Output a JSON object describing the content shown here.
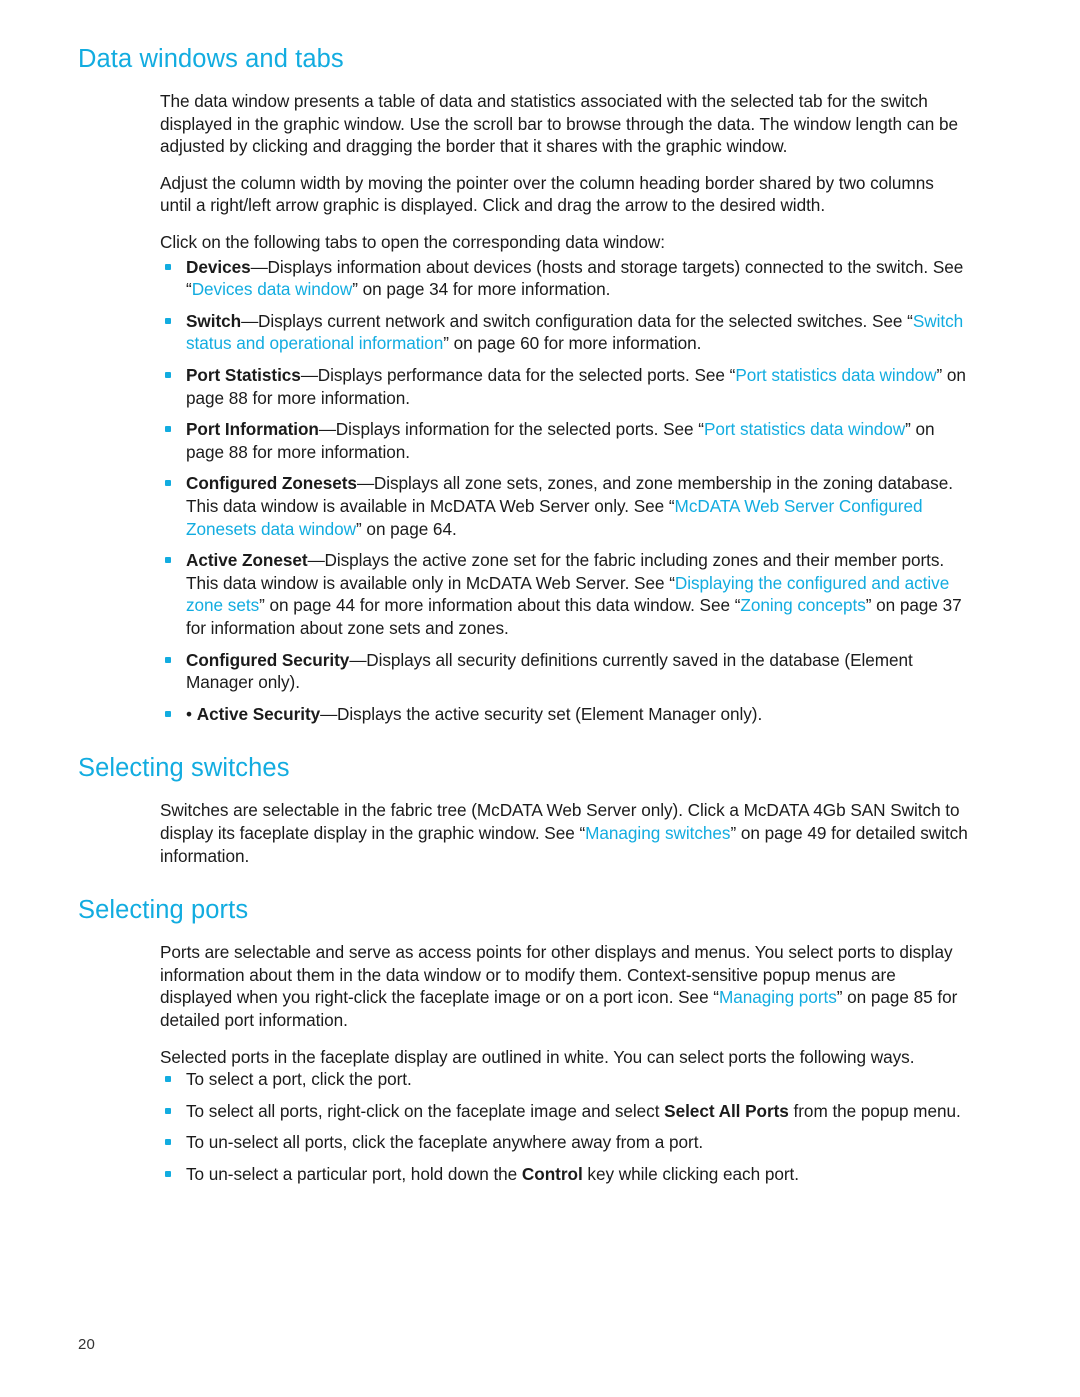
{
  "document": {
    "page_number": "20"
  },
  "sections": [
    {
      "heading": "Data windows and tabs",
      "paragraphs": [
        "The data window presents a table of data and statistics associated with the selected tab for the switch displayed in the graphic window. Use the scroll bar to browse through the data. The window length can be adjusted by clicking and dragging the border that it shares with the graphic window.",
        "Adjust the column width by moving the pointer over the column heading border shared by two columns until a right/left arrow graphic is displayed. Click and drag the arrow to the desired width.",
        "Click on the following tabs to open the corresponding data window:"
      ]
    },
    {
      "heading": "Selecting switches",
      "paragraphs": [
        "Switches are selectable in the fabric tree (McDATA Web Server only). Click a McDATA 4Gb SAN Switch to display its faceplate display in the graphic window. See “Managing switches” on page 49 for detailed switch information."
      ]
    },
    {
      "heading": "Selecting ports",
      "paragraphs": [
        "Ports are selectable and serve as access points for other displays and menus. You select ports to display information about them in the data window or to modify them. Context-sensitive popup menus are displayed when you right-click the faceplate image or on a port icon. See “Managing ports” on page 85 for detailed port information.",
        "Selected ports in the faceplate display are outlined in white. You can select ports the following ways."
      ]
    }
  ],
  "tabs_list": [
    {
      "term": "Devices",
      "dash": "—",
      "text_1": "Displays information about devices (hosts and storage targets) connected to the switch. See “",
      "link": "Devices data window",
      "text_2": "” on page 34 for more information."
    },
    {
      "term": "Switch",
      "dash": "—",
      "text_1": "Displays current network and switch configuration data for the selected switches. See “",
      "link": "Switch status and operational information",
      "text_2": "” on page 60 for more information."
    },
    {
      "term": "Port Statistics",
      "dash": "—",
      "text_1": "Displays performance data for the selected ports. See “",
      "link": "Port statistics data window",
      "text_2": "” on page 88 for more information."
    },
    {
      "term": "Port Information",
      "dash": "—",
      "text_1": "Displays information for the selected ports. See “",
      "link": "Port statistics data window",
      "text_2": "” on page 88 for more information."
    },
    {
      "term": "Configured Zonesets",
      "dash": "—",
      "text_1": "Displays all zone sets, zones, and zone membership in the zoning database. This data window is available in McDATA Web Server only. See “",
      "link": "McDATA Web Server Configured Zonesets data window",
      "text_2": "” on page 64."
    },
    {
      "term": "Active Zoneset",
      "dash": "—",
      "text_1": "Displays the active zone set for the fabric including zones and their member ports. This data window is available only in McDATA Web Server. See “",
      "link": "Displaying the configured and active zone sets",
      "text_2": "” on page 44 for more information about this data window. See “",
      "link_2": "Zoning concepts",
      "text_3": "” on page 37 for information about zone sets and zones."
    },
    {
      "term": "Configured Security",
      "dash": "—",
      "text_1": "Displays all security definitions currently saved in the database (Element Manager only).",
      "link": "",
      "text_2": ""
    },
    {
      "prefix": "• ",
      "term": "Active Security",
      "dash": "—",
      "text_1": "Displays the active security set (Element Manager only).",
      "link": "",
      "text_2": ""
    }
  ],
  "port_selection_list": [
    {
      "text_1": "To select a port, click the port.",
      "bold": "",
      "text_2": ""
    },
    {
      "text_1": "To select all ports, right-click on the faceplate image and select ",
      "bold": "Select All Ports",
      "text_2": " from the popup menu."
    },
    {
      "text_1": "To un-select all ports, click the faceplate anywhere away from a port.",
      "bold": "",
      "text_2": ""
    },
    {
      "text_1": "To un-select a particular port, hold down the ",
      "bold": "Control",
      "text_2": " key while clicking each port."
    }
  ]
}
